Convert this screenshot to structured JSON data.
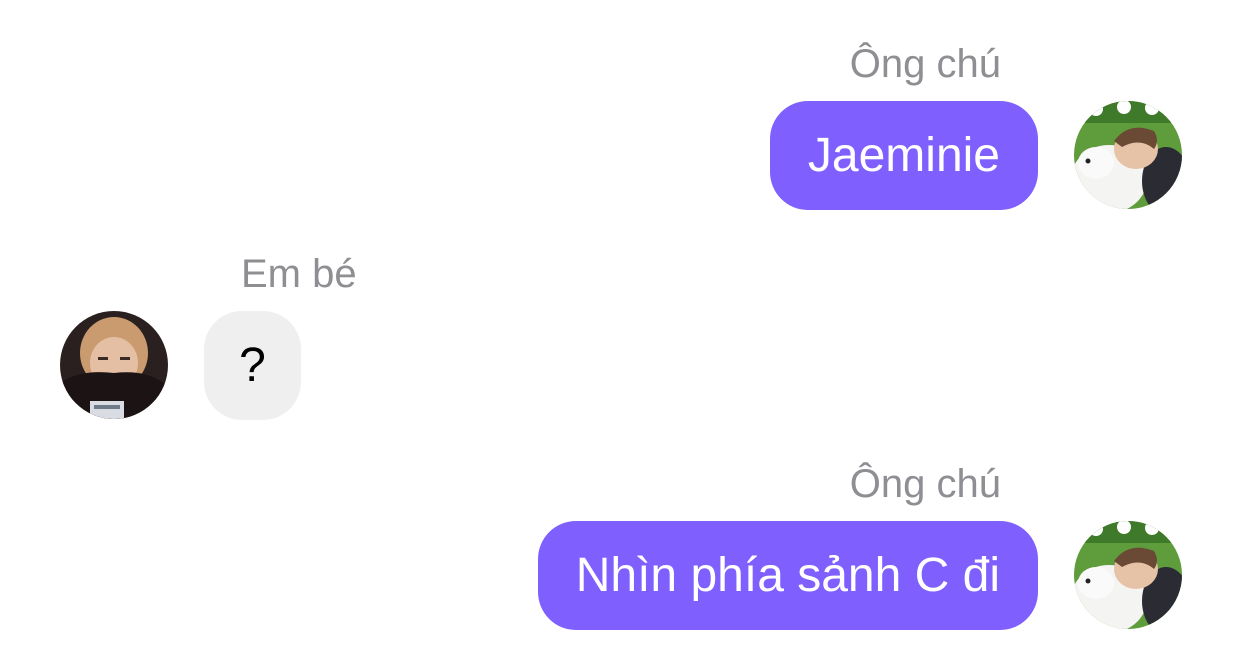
{
  "colors": {
    "outgoing_bubble": "#7f5ffd",
    "incoming_bubble": "#efefef",
    "sender_name": "#8e8e93"
  },
  "messages": [
    {
      "sender": "Ông chú",
      "text": "Jaeminie",
      "direction": "outgoing",
      "avatar_icon": "user-avatar-with-dog"
    },
    {
      "sender": "Em bé",
      "text": "?",
      "direction": "incoming",
      "avatar_icon": "user-avatar-blond-hair"
    },
    {
      "sender": "Ông chú",
      "text": "Nhìn phía sảnh C đi",
      "direction": "outgoing",
      "avatar_icon": "user-avatar-with-dog"
    }
  ]
}
